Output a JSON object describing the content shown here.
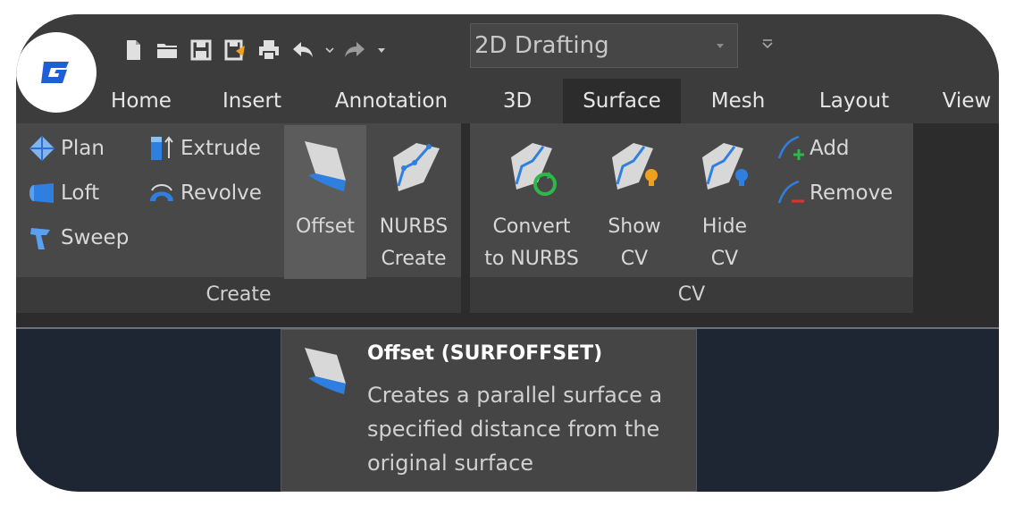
{
  "workspace": {
    "value": "2D Drafting"
  },
  "tabs": [
    {
      "label": "Home"
    },
    {
      "label": "Insert"
    },
    {
      "label": "Annotation"
    },
    {
      "label": "3D"
    },
    {
      "label": "Surface"
    },
    {
      "label": "Mesh"
    },
    {
      "label": "Layout"
    },
    {
      "label": "View"
    }
  ],
  "active_tab": "Surface",
  "panels": {
    "create": {
      "title": "Create",
      "items": {
        "plan": "Plan",
        "extrude": "Extrude",
        "loft": "Loft",
        "revolve": "Revolve",
        "sweep": "Sweep",
        "offset": "Offset",
        "nurbs_line1": "NURBS",
        "nurbs_line2": "Create"
      }
    },
    "cv": {
      "title": "CV",
      "items": {
        "convert_line1": "Convert",
        "convert_line2": "to NURBS",
        "show_line1": "Show",
        "show_line2": "CV",
        "hide_line1": "Hide",
        "hide_line2": "CV",
        "add": "Add",
        "remove": "Remove"
      }
    }
  },
  "tooltip": {
    "title": "Offset (SURFOFFSET)",
    "description": "Creates a parallel surface a specified distance from the original surface"
  },
  "colors": {
    "accent_blue": "#2f7fe0",
    "surface_gray": "#d8d8d8",
    "green": "#2fb84a",
    "orange": "#f0a020",
    "red": "#e03030"
  },
  "icons": {
    "logo": "gstarcad-logo",
    "quick_access": [
      "new-icon",
      "open-icon",
      "save-icon",
      "save-as-icon",
      "print-icon",
      "undo-icon",
      "redo-icon"
    ]
  }
}
